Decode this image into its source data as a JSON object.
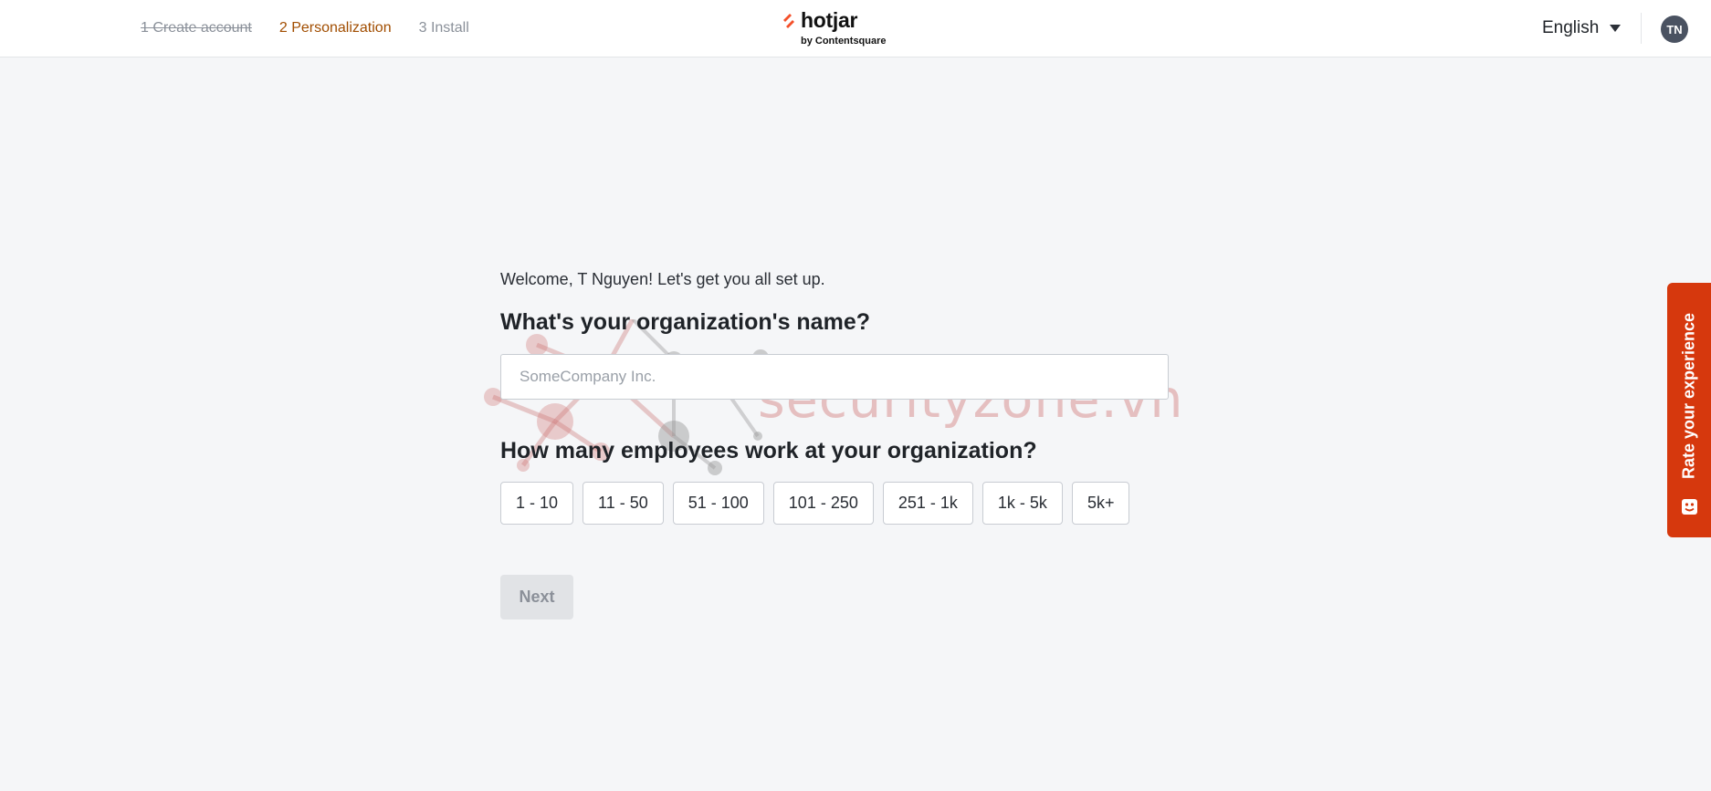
{
  "header": {
    "steps": [
      {
        "label": "1 Create account",
        "state": "done"
      },
      {
        "label": "2 Personalization",
        "state": "active"
      },
      {
        "label": "3 Install",
        "state": "todo"
      }
    ],
    "logo": {
      "word": "hotjar",
      "sub": "by Contentsquare"
    },
    "language": "English",
    "avatar_initials": "TN"
  },
  "form": {
    "welcome": "Welcome, T Nguyen! Let's get you all set up.",
    "org_question": "What's your organization's name?",
    "org_placeholder": "SomeCompany Inc.",
    "org_value": "",
    "employees_question": "How many employees work at your organization?",
    "employee_options": [
      "1 - 10",
      "11 - 50",
      "51 - 100",
      "101 - 250",
      "251 - 1k",
      "1k - 5k",
      "5k+"
    ],
    "next_label": "Next"
  },
  "feedback_tab": {
    "label": "Rate your experience"
  },
  "watermark": {
    "text": "securityzone.vn"
  },
  "colors": {
    "accent_step": "#a14d00",
    "feedback_bg": "#d6380d",
    "page_bg": "#f5f6f8",
    "logo_accent": "#f4502a"
  }
}
